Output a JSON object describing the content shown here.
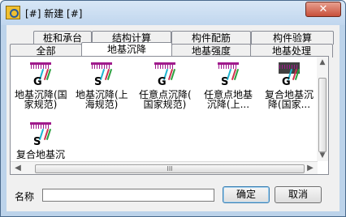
{
  "window": {
    "title": "[#] 新建 [#]",
    "close_glyph": "✕"
  },
  "tabs": {
    "row_top": [
      {
        "label": "桩和承台"
      },
      {
        "label": "结构计算"
      },
      {
        "label": "构件配筋"
      },
      {
        "label": "构件验算"
      }
    ],
    "row_bottom": [
      {
        "label": "全部"
      },
      {
        "label": "地基沉降",
        "active": true
      },
      {
        "label": "地基强度"
      },
      {
        "label": "地基处理"
      }
    ]
  },
  "items": [
    {
      "letter": "G",
      "label": "地基沉降(国\n家规范)",
      "icon": "settlement-icon",
      "selected": true
    },
    {
      "letter": "S",
      "label": "地基沉降(上\n海规范)",
      "icon": "settlement-icon"
    },
    {
      "letter": "G",
      "label": "任意点沉降(\n国家规范)",
      "icon": "settlement-icon"
    },
    {
      "letter": "S",
      "label": "任意点地基\n沉降(上...",
      "icon": "settlement-icon"
    },
    {
      "letter": "G",
      "label": "复合地基沉\n降(国家...",
      "icon": "composite-settlement-icon"
    },
    {
      "letter": "S",
      "label": "复合地基沉",
      "icon": "composite-settlement-icon"
    }
  ],
  "scroll": {
    "thumb_grip": "III",
    "left_arrow": "◀",
    "right_arrow": "▶",
    "up_arrow": "▲",
    "down_arrow": "▼"
  },
  "form": {
    "name_label": "名称",
    "name_value": ""
  },
  "buttons": {
    "ok": "确定",
    "cancel": "取消"
  }
}
